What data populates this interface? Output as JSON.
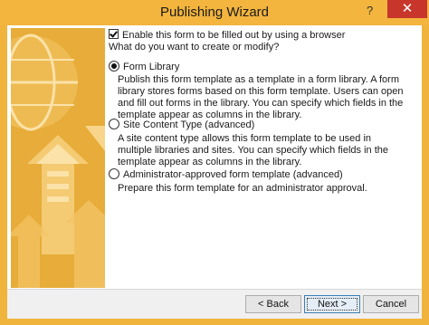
{
  "window": {
    "title": "Publishing Wizard",
    "help_label": "?",
    "close_label": "✕"
  },
  "options": {
    "enable_browser_label": "Enable this form to be filled out by using a browser",
    "question": "What do you want to create or modify?",
    "form_library": {
      "label": "Form Library",
      "description": "Publish this form template as a template in a form library. A form library stores forms based on this form template. Users can open and fill out forms in the library. You can specify which fields in the template appear as columns in the library."
    },
    "site_content_type": {
      "label": "Site Content Type (advanced)",
      "description": "A site content type allows this form template to be used in multiple libraries and sites. You can specify which fields in the template appear as columns in the library."
    },
    "admin_approved": {
      "label": "Administrator-approved form template (advanced)",
      "description": "Prepare this form template for an administrator approval."
    }
  },
  "buttons": {
    "back": "< Back",
    "next": "Next >",
    "cancel": "Cancel"
  },
  "colors": {
    "frame": "#f0b43c",
    "close": "#c8362b",
    "banner": "#e7ac39"
  },
  "icons": {
    "banner": "globe-upload-arrows-icon"
  }
}
